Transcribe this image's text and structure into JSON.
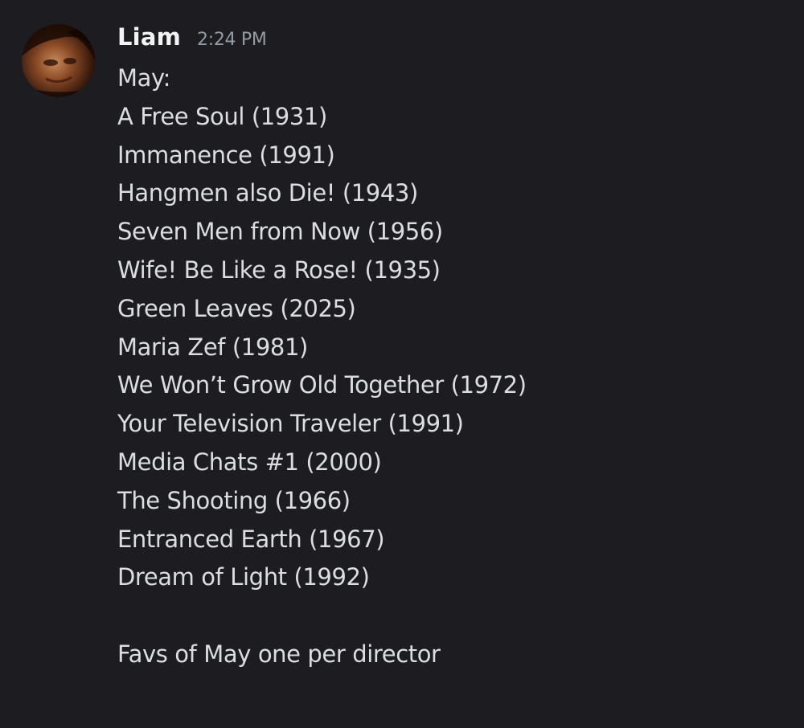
{
  "message": {
    "author": "Liam",
    "timestamp": "2:24 PM",
    "avatar_icon": "user-avatar-photo",
    "lines": [
      "May:",
      "A Free Soul (1931)",
      "Immanence (1991)",
      "Hangmen also Die! (1943)",
      "Seven Men from Now (1956)",
      "Wife! Be Like a Rose! (1935)",
      "Green Leaves (2025)",
      "Maria Zef (1981)",
      "We Won’t Grow Old Together (1972)",
      "Your Television Traveler (1991)",
      "Media Chats #1 (2000)",
      "The Shooting (1966)",
      "Entranced Earth (1967)",
      "Dream of Light (1992)"
    ],
    "footer_line": "Favs of May one per director"
  },
  "colors": {
    "background": "#1c1c21",
    "author": "#f2f3f5",
    "timestamp": "#949ba4",
    "text": "#dbdee1"
  }
}
